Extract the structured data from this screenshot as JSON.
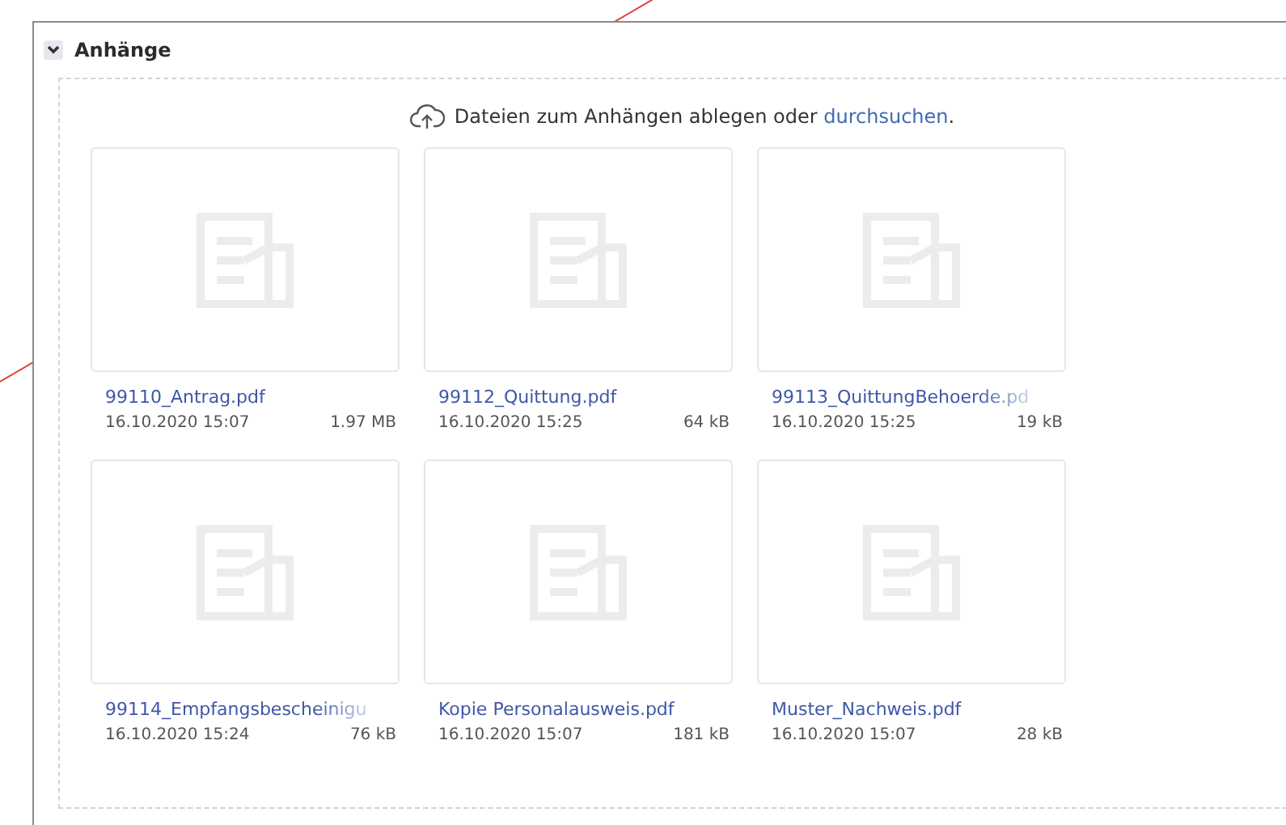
{
  "section": {
    "title": "Anhänge",
    "expanded": true
  },
  "dropzone": {
    "text": "Dateien zum Anhängen ablegen oder",
    "link": "durchsuchen",
    "end": "."
  },
  "files": [
    {
      "name": "99110_Antrag.pdf",
      "date": "16.10.2020 15:07",
      "size": "1.97 MB",
      "truncated": false
    },
    {
      "name": "99112_Quittung.pdf",
      "date": "16.10.2020 15:25",
      "size": "64 kB",
      "truncated": false
    },
    {
      "name": "99113_QuittungBehoerde.pd",
      "date": "16.10.2020 15:25",
      "size": "19 kB",
      "truncated": true
    },
    {
      "name": "99114_Empfangsbescheinigu",
      "date": "16.10.2020 15:24",
      "size": "76 kB",
      "truncated": true
    },
    {
      "name": "Kopie Personalausweis.pdf",
      "date": "16.10.2020 15:07",
      "size": "181 kB",
      "truncated": false
    },
    {
      "name": "Muster_Nachweis.pdf",
      "date": "16.10.2020 15:07",
      "size": "28 kB",
      "truncated": false
    }
  ]
}
